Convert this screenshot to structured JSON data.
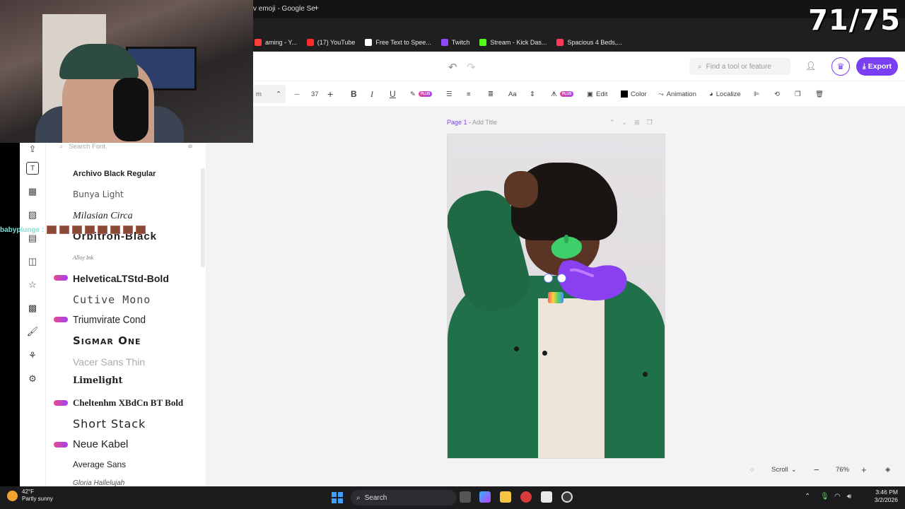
{
  "browser": {
    "tab_title": "v emoji - Google Se",
    "bookmarks": [
      {
        "label": "aming - Y...",
        "color": "#ff3b3b"
      },
      {
        "label": "(17) YouTube",
        "color": "#ff2a2a"
      },
      {
        "label": "Free Text to Spee...",
        "color": "#ffffff"
      },
      {
        "label": "Twitch",
        "color": "#9146ff"
      },
      {
        "label": "Stream - Kick Das...",
        "color": "#53fc18"
      },
      {
        "label": "Spacious 4 Beds,...",
        "color": "#ff385c"
      }
    ]
  },
  "overlay": {
    "counter": "71/75",
    "chat_user": "babyplunge :"
  },
  "header": {
    "search_placeholder": "Find a tool or feature",
    "export_label": "Export"
  },
  "format_bar": {
    "font_field": "m",
    "font_size": "37",
    "edit_label": "Edit",
    "color_label": "Color",
    "animation_label": "Animation",
    "localize_label": "Localize",
    "plus_tag": "PLUS"
  },
  "font_panel": {
    "search_placeholder": "Search Font",
    "fonts": [
      {
        "name": "Archivo Black Regular",
        "plus": false
      },
      {
        "name": "Bunya Light",
        "plus": false
      },
      {
        "name": "Milasian Circa",
        "plus": false
      },
      {
        "name": "Orbitron-Black",
        "plus": false
      },
      {
        "name": "Alloy Ink",
        "plus": false
      },
      {
        "name": "HelveticaLTStd-Bold",
        "plus": true
      },
      {
        "name": "Cutive Mono",
        "plus": false
      },
      {
        "name": "Triumvirate Cond",
        "plus": true
      },
      {
        "name": "Sigmar One",
        "plus": false
      },
      {
        "name": "Vacer Sans Thin",
        "plus": false
      },
      {
        "name": "Limelight",
        "plus": false
      },
      {
        "name": "Cheltenhm XBdCn BT Bold",
        "plus": true
      },
      {
        "name": "Short Stack",
        "plus": false
      },
      {
        "name": "Neue Kabel",
        "plus": true
      },
      {
        "name": "Average Sans",
        "plus": false
      },
      {
        "name": "Gloria Hallelujah",
        "plus": false
      }
    ]
  },
  "canvas": {
    "page_label": "Page 1 -",
    "add_title": "Add Title"
  },
  "zoom": {
    "mode": "Scroll",
    "level": "76%"
  },
  "taskbar": {
    "temp": "42°F",
    "weather": "Partly sunny",
    "search_label": "Search",
    "time": "3:46 PM",
    "date": "3/2/2026"
  }
}
